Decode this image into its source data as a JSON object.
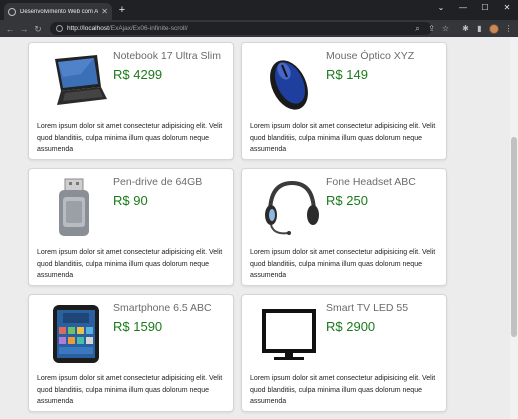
{
  "browser": {
    "tab_title": "Desenvolvimento Web com AJAX",
    "url_host": "http://localhost",
    "url_path": "/ExAjax/Ex06-infinite-scroll/"
  },
  "products": [
    {
      "name": "Notebook 17 Ultra Slim",
      "price": "R$ 4299",
      "image": "laptop-image"
    },
    {
      "name": "Mouse Óptico XYZ",
      "price": "R$ 149",
      "image": "mouse-image"
    },
    {
      "name": "Pen-drive de 64GB",
      "price": "R$ 90",
      "image": "usb-drive-image"
    },
    {
      "name": "Fone Headset ABC",
      "price": "R$ 250",
      "image": "headset-image"
    },
    {
      "name": "Smartphone 6.5 ABC",
      "price": "R$ 1590",
      "image": "smartphone-image"
    },
    {
      "name": "Smart TV LED 55",
      "price": "R$ 2900",
      "image": "tv-image"
    }
  ],
  "description": "Lorem ipsum dolor sit amet consectetur adipisicing elit. Velit quod blanditiis, culpa minima illum quas dolorum neque assumenda",
  "colors": {
    "price": "#1a7a1a",
    "name": "#6b6b6b"
  }
}
